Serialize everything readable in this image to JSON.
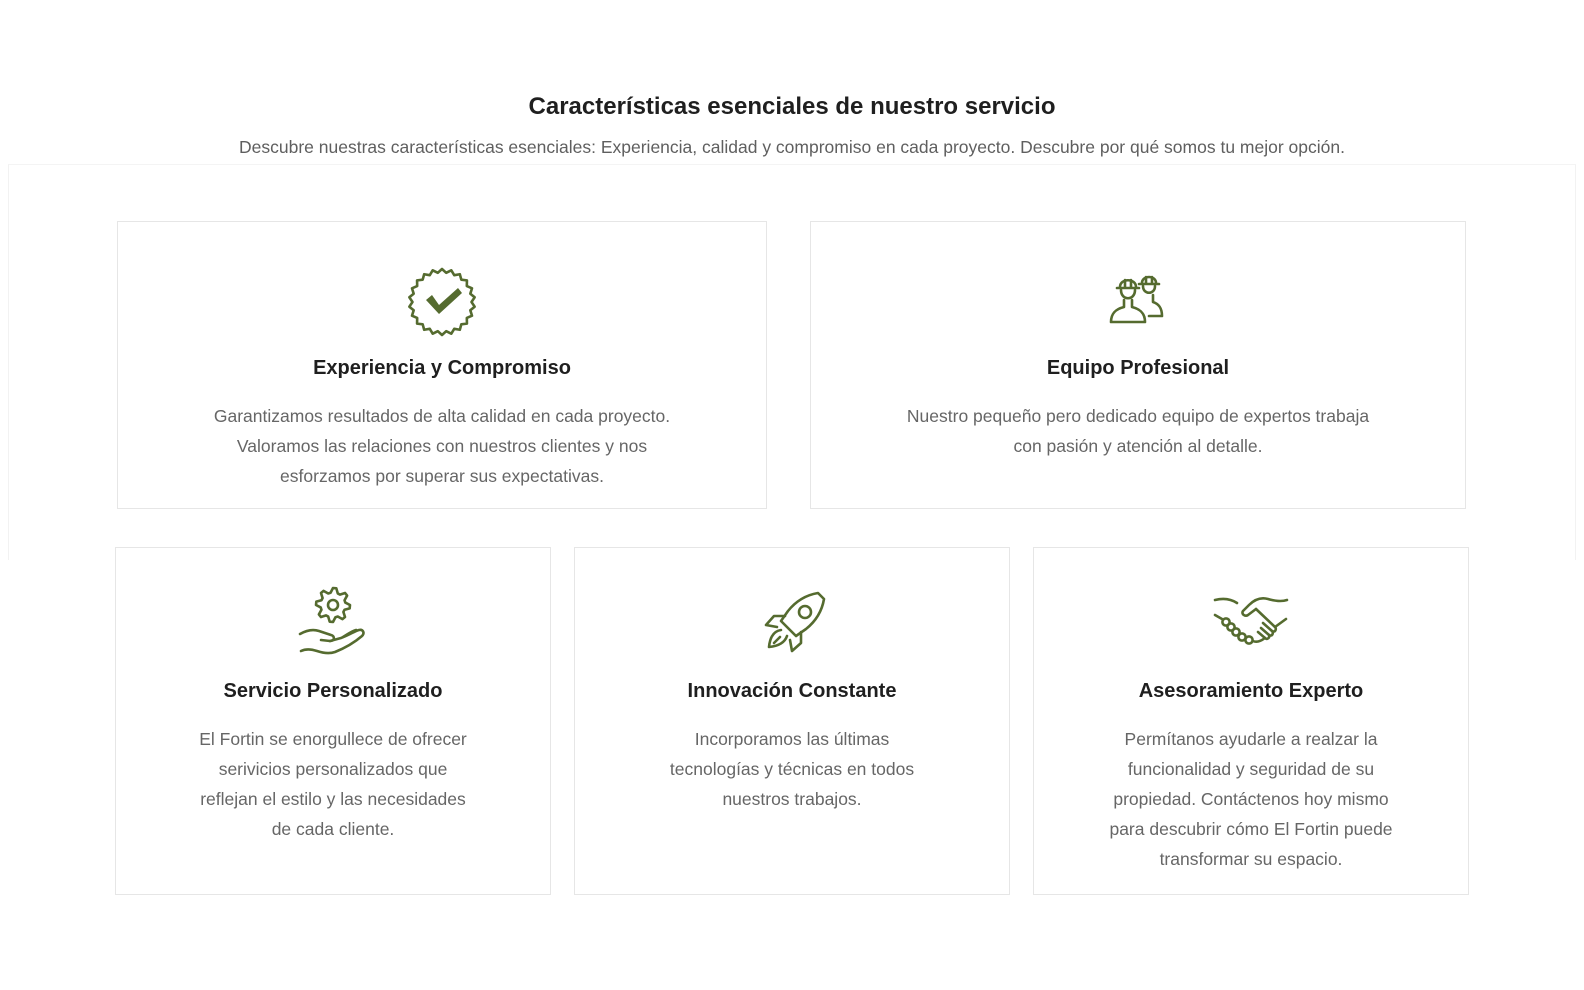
{
  "section": {
    "title": "Características esenciales de nuestro servicio",
    "subtitle": "Descubre nuestras características esenciales: Experiencia, calidad y compromiso en cada proyecto. Descubre por qué somos tu mejor opción."
  },
  "colors": {
    "accent": "#556b2f",
    "heading": "#1f1f1f",
    "body_text": "#666666",
    "card_border": "#e6e6e6"
  },
  "cards": [
    {
      "icon": "badge-check-icon",
      "title": "Experiencia y Compromiso",
      "text": "Garantizamos resultados de alta calidad en cada proyecto. Valoramos las relaciones con nuestros clientes y nos esforzamos por superar sus expectativas."
    },
    {
      "icon": "workers-team-icon",
      "title": "Equipo Profesional",
      "text": "Nuestro pequeño pero dedicado equipo de expertos trabaja con pasión y atención al detalle."
    },
    {
      "icon": "hand-gear-icon",
      "title": "Servicio Personalizado",
      "text": "El Fortin se enorgullece de ofrecer serivicios personalizados que reflejan el estilo y las necesidades de cada cliente."
    },
    {
      "icon": "rocket-icon",
      "title": "Innovación Constante",
      "text": "Incorporamos las últimas tecnologías y técnicas en todos nuestros trabajos."
    },
    {
      "icon": "handshake-icon",
      "title": "Asesoramiento Experto",
      "text": "Permítanos ayudarle a realzar la funcionalidad y seguridad de su propiedad. Contáctenos hoy mismo para descubrir cómo El Fortin puede transformar su espacio."
    }
  ]
}
